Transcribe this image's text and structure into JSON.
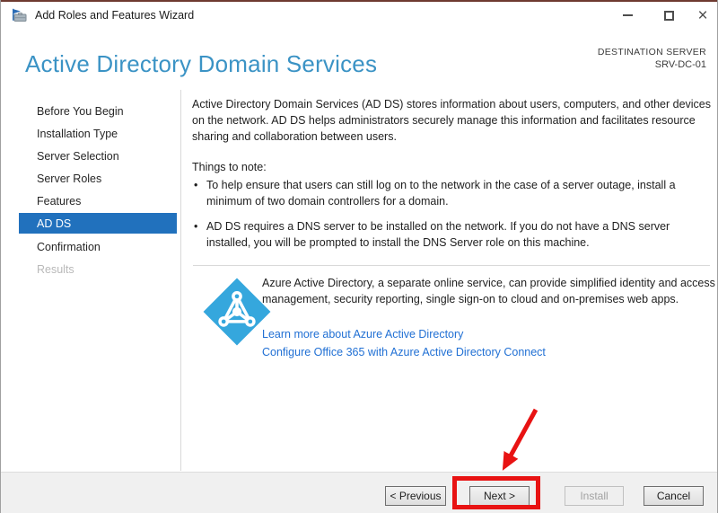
{
  "window": {
    "title": "Add Roles and Features Wizard",
    "icons": {
      "app": "server-manager-icon",
      "minimize": "minimize-icon",
      "maximize": "maximize-icon",
      "close": "close-icon"
    },
    "close_glyph": "×"
  },
  "header": {
    "title": "Active Directory Domain Services",
    "destination_label": "DESTINATION SERVER",
    "destination_server": "SRV-DC-01"
  },
  "sidebar": {
    "items": [
      {
        "label": "Before You Begin",
        "state": "enabled"
      },
      {
        "label": "Installation Type",
        "state": "enabled"
      },
      {
        "label": "Server Selection",
        "state": "enabled"
      },
      {
        "label": "Server Roles",
        "state": "enabled"
      },
      {
        "label": "Features",
        "state": "enabled"
      },
      {
        "label": "AD DS",
        "state": "selected"
      },
      {
        "label": "Confirmation",
        "state": "enabled"
      },
      {
        "label": "Results",
        "state": "disabled"
      }
    ]
  },
  "main": {
    "intro": "Active Directory Domain Services (AD DS) stores information about users, computers, and other devices on the network.  AD DS helps administrators securely manage this information and facilitates resource sharing and collaboration between users.",
    "things_to_note_label": "Things to note:",
    "bullets": [
      "To help ensure that users can still log on to the network in the case of a server outage, install a minimum of two domain controllers for a domain.",
      "AD DS requires a DNS server to be installed on the network.  If you do not have a DNS server installed, you will be prompted to install the DNS Server role on this machine."
    ],
    "azure": {
      "icon": "azure-active-directory-icon",
      "text": "Azure Active Directory, a separate online service, can provide simplified identity and access management, security reporting, single sign-on to cloud and on-premises web apps.",
      "links": [
        "Learn more about Azure Active Directory",
        "Configure Office 365 with Azure Active Directory Connect"
      ]
    }
  },
  "footer": {
    "buttons": [
      {
        "label": "< Previous",
        "enabled": true
      },
      {
        "label": "Next >",
        "enabled": true,
        "highlighted": true
      },
      {
        "label": "Install",
        "enabled": false
      },
      {
        "label": "Cancel",
        "enabled": true
      }
    ]
  },
  "colors": {
    "header_title": "#3b93c5",
    "sidebar_selected_bg": "#2171bd",
    "link": "#2170d4",
    "azure_icon_blue": "#35a7dd",
    "annotation_red": "#e81313",
    "footer_bg": "#f0f0f0"
  }
}
